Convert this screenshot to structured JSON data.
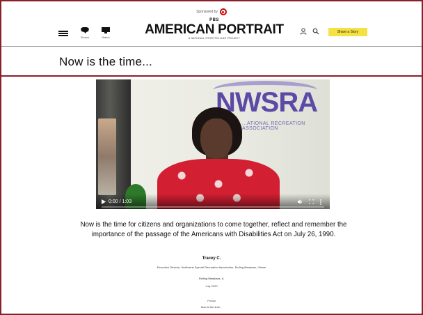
{
  "header": {
    "sponsor_text": "Sponsored by",
    "logo_pbs": "PBS",
    "logo_title": "AMERICAN PORTRAIT",
    "logo_tagline": "A NATIONAL STORYTELLING PROJECT",
    "nav": [
      {
        "icon": "us-map-icon",
        "caption": "Stories"
      },
      {
        "icon": "monitor-icon",
        "caption": "Watch"
      }
    ],
    "cta_label": "Share a Story"
  },
  "page": {
    "title": "Now is the time..."
  },
  "video": {
    "banner_text": "NWSRA",
    "banner_subtitle": "...ATIONAL RECREATION ASSOCIATION",
    "time": "0:00 / 1:03",
    "progress": 0.0
  },
  "story": {
    "description": "Now is the time for citizens and organizations to come together, reflect and remember the importance of the passage of the Americans with Disabilities Act on July 26, 1990.",
    "author": "Tracey C.",
    "author_title": "Executive Director, Northwest Special Recreation Association, Rolling Meadows, Illinois",
    "location": "Rolling Meadows, IL",
    "date": "July 2020",
    "prompt_label": "Prompt",
    "prompt": "Now is the time..."
  }
}
